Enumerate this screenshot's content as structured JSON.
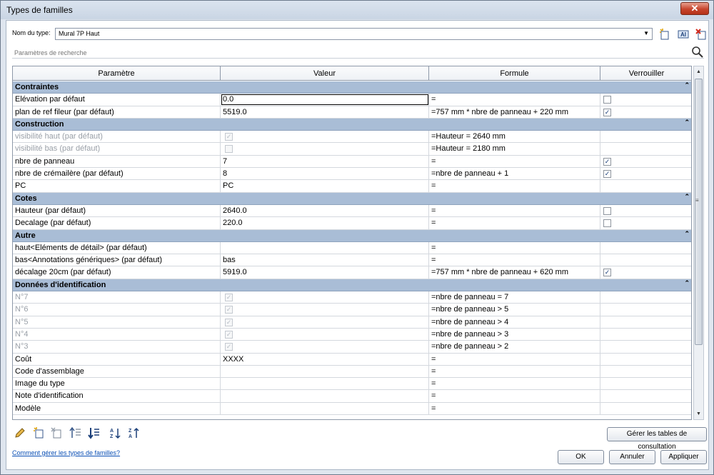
{
  "window": {
    "title": "Types de familles",
    "close_glyph": "✕"
  },
  "type_selector": {
    "label": "Nom du type:",
    "value": "Mural 7P Haut"
  },
  "search": {
    "placeholder": "Paramètres de recherche"
  },
  "columns": [
    "Paramètre",
    "Valeur",
    "Formule",
    "Verrouiller"
  ],
  "groups": [
    {
      "title": "Contraintes",
      "rows": [
        {
          "param": "Elévation par défaut",
          "value": "0.0",
          "formula": "=",
          "lock": "unchecked",
          "editing": true
        },
        {
          "param": "plan de ref fileur (par défaut)",
          "value": "5519.0",
          "formula": "=757 mm * nbre de panneau + 220 mm",
          "lock": "checked"
        }
      ]
    },
    {
      "title": "Construction",
      "rows": [
        {
          "param": "visibilité haut (par défaut)",
          "value_check": "checked",
          "formula": "=Hauteur = 2640 mm",
          "lock": "none",
          "disabled": true
        },
        {
          "param": "visibilité bas (par défaut)",
          "value_check": "unchecked",
          "formula": "=Hauteur = 2180 mm",
          "lock": "none",
          "disabled": true
        },
        {
          "param": "nbre de panneau",
          "value": "7",
          "formula": "=",
          "lock": "checked"
        },
        {
          "param": "nbre de crémailère (par défaut)",
          "value": "8",
          "formula": "=nbre de panneau + 1",
          "lock": "checked"
        },
        {
          "param": "PC",
          "value": "PC",
          "formula": "=",
          "lock": "none"
        }
      ]
    },
    {
      "title": "Cotes",
      "rows": [
        {
          "param": "Hauteur (par défaut)",
          "value": "2640.0",
          "formula": "=",
          "lock": "unchecked"
        },
        {
          "param": "Decalage (par défaut)",
          "value": "220.0",
          "formula": "=",
          "lock": "unchecked"
        }
      ]
    },
    {
      "title": "Autre",
      "rows": [
        {
          "param": "haut<Eléments de détail> (par défaut)",
          "value": "",
          "formula": "=",
          "lock": "none"
        },
        {
          "param": "bas<Annotations génériques> (par défaut)",
          "value": "bas",
          "formula": "=",
          "lock": "none"
        },
        {
          "param": "décalage 20cm (par défaut)",
          "value": "5919.0",
          "formula": "=757 mm * nbre de panneau + 620 mm",
          "lock": "checked"
        }
      ]
    },
    {
      "title": "Données d'identification",
      "rows": [
        {
          "param": "N°7",
          "value_check": "checked",
          "formula": "=nbre de panneau = 7",
          "lock": "none",
          "disabled": true
        },
        {
          "param": "N°6",
          "value_check": "checked",
          "formula": "=nbre de panneau > 5",
          "lock": "none",
          "disabled": true
        },
        {
          "param": "N°5",
          "value_check": "checked",
          "formula": "=nbre de panneau > 4",
          "lock": "none",
          "disabled": true
        },
        {
          "param": "N°4",
          "value_check": "checked",
          "formula": "=nbre de panneau > 3",
          "lock": "none",
          "disabled": true
        },
        {
          "param": "N°3",
          "value_check": "checked",
          "formula": "=nbre de panneau > 2",
          "lock": "none",
          "disabled": true
        },
        {
          "param": "Coût",
          "value": "  XXXX",
          "formula": "=",
          "lock": "none"
        },
        {
          "param": "Code d'assemblage",
          "value": "",
          "formula": "=",
          "lock": "none"
        },
        {
          "param": "Image du type",
          "value": "",
          "formula": "=",
          "lock": "none"
        },
        {
          "param": "Note d'identification",
          "value": "",
          "formula": "=",
          "lock": "none"
        },
        {
          "param": "Modèle",
          "value": "",
          "formula": "=",
          "lock": "none"
        }
      ]
    }
  ],
  "buttons": {
    "lookup": "Gérer les tables de consultation",
    "ok": "OK",
    "cancel": "Annuler",
    "apply": "Appliquer"
  },
  "help_link": "Comment gérer les types de familles?",
  "icons": {
    "toolbar": [
      "new-type-icon",
      "rename-type-icon",
      "delete-type-icon"
    ],
    "bottom": [
      "edit-parameter-icon",
      "new-parameter-icon",
      "delete-parameter-icon",
      "move-up-icon",
      "move-down-icon",
      "sort-ascending-icon",
      "sort-descending-icon"
    ]
  },
  "colors": {
    "group_header": "#a9bdd6",
    "accent": "#1b3f79",
    "link": "#0b4fb5"
  }
}
